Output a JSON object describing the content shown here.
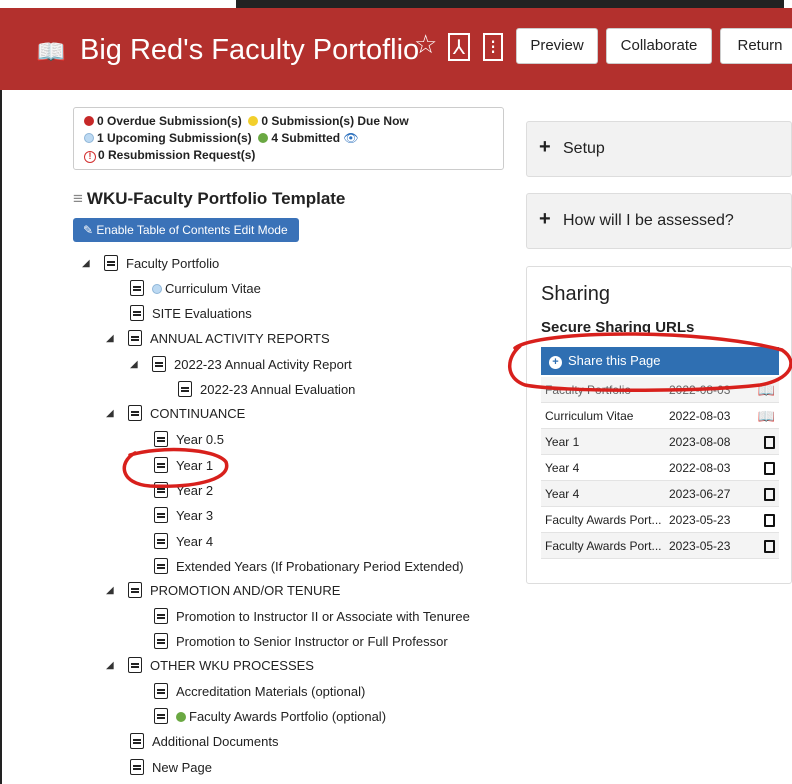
{
  "header": {
    "title": "Big Red's Faculty Portoflio",
    "buttons": {
      "preview": "Preview",
      "collaborate": "Collaborate",
      "return": "Return"
    }
  },
  "status": {
    "overdue": "0 Overdue Submission(s)",
    "due_now": "0 Submission(s) Due Now",
    "upcoming": "1 Upcoming Submission(s)",
    "submitted": "4 Submitted",
    "resubmission": "0 Resubmission Request(s)"
  },
  "template": {
    "title": "WKU-Faculty Portfolio Template",
    "toc_button": "Enable Table of Contents Edit Mode"
  },
  "tree": [
    {
      "label": "Faculty Portfolio"
    },
    {
      "label": "Curriculum Vitae"
    },
    {
      "label": "SITE Evaluations"
    },
    {
      "label": "ANNUAL ACTIVITY REPORTS"
    },
    {
      "label": "2022-23 Annual Activity Report"
    },
    {
      "label": "2022-23 Annual Evaluation"
    },
    {
      "label": "CONTINUANCE"
    },
    {
      "label": "Year 0.5"
    },
    {
      "label": "Year 1"
    },
    {
      "label": "Year 2"
    },
    {
      "label": "Year 3"
    },
    {
      "label": "Year 4"
    },
    {
      "label": "Extended Years (If Probationary Period Extended)"
    },
    {
      "label": "PROMOTION AND/OR TENURE"
    },
    {
      "label": "Promotion to Instructor II or Associate with Tenuree"
    },
    {
      "label": "Promotion to Senior Instructor or Full Professor"
    },
    {
      "label": "OTHER WKU PROCESSES"
    },
    {
      "label": "Accreditation Materials (optional)"
    },
    {
      "label": "Faculty Awards Portfolio (optional)"
    },
    {
      "label": "Additional Documents"
    },
    {
      "label": "New Page"
    }
  ],
  "right": {
    "setup": "Setup",
    "assess": "How will I be assessed?",
    "sharing_title": "Sharing",
    "sharing_sub": "Secure Sharing URLs",
    "share_button": "Share this Page",
    "rows": [
      {
        "name": "Faculty Portfolio",
        "date": "2022-08-03",
        "icon": "book-icon"
      },
      {
        "name": "Curriculum Vitae",
        "date": "2022-08-03",
        "icon": "book-icon"
      },
      {
        "name": "Year 1",
        "date": "2023-08-08",
        "icon": "file-icon"
      },
      {
        "name": "Year 4",
        "date": "2022-08-03",
        "icon": "file-icon"
      },
      {
        "name": "Year 4",
        "date": "2023-06-27",
        "icon": "file-icon"
      },
      {
        "name": "Faculty Awards Port...",
        "date": "2023-05-23",
        "icon": "file-icon"
      },
      {
        "name": "Faculty Awards Port...",
        "date": "2023-05-23",
        "icon": "file-icon"
      }
    ]
  }
}
